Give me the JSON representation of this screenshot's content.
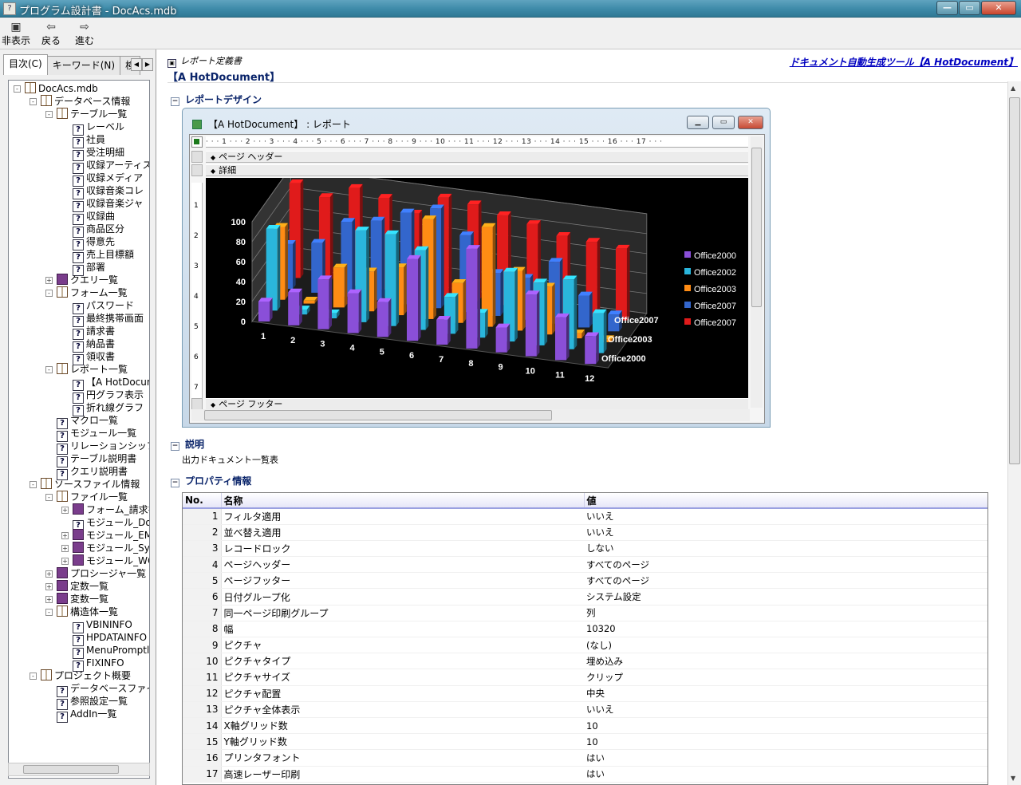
{
  "window": {
    "title": "プログラム設計書 - DocAcs.mdb"
  },
  "toolbar": {
    "hide": "非表示",
    "back": "戻る",
    "forward": "進む"
  },
  "left": {
    "tabs": [
      "目次(C)",
      "キーワード(N)",
      "検"
    ],
    "tree": [
      {
        "label": "DocAcs.mdb",
        "level": 0,
        "icon": "book-open",
        "exp": "-"
      },
      {
        "label": "データベース情報",
        "level": 1,
        "icon": "book-open",
        "exp": "-"
      },
      {
        "label": "テーブル一覧",
        "level": 2,
        "icon": "book-open",
        "exp": "-"
      },
      {
        "label": "レーベル",
        "level": 3,
        "icon": "page",
        "exp": ""
      },
      {
        "label": "社員",
        "level": 3,
        "icon": "page",
        "exp": ""
      },
      {
        "label": "受注明細",
        "level": 3,
        "icon": "page",
        "exp": ""
      },
      {
        "label": "収録アーティス",
        "level": 3,
        "icon": "page",
        "exp": ""
      },
      {
        "label": "収録メディア",
        "level": 3,
        "icon": "page",
        "exp": ""
      },
      {
        "label": "収録音楽コレ",
        "level": 3,
        "icon": "page",
        "exp": ""
      },
      {
        "label": "収録音楽ジャ",
        "level": 3,
        "icon": "page",
        "exp": ""
      },
      {
        "label": "収録曲",
        "level": 3,
        "icon": "page",
        "exp": ""
      },
      {
        "label": "商品区分",
        "level": 3,
        "icon": "page",
        "exp": ""
      },
      {
        "label": "得意先",
        "level": 3,
        "icon": "page",
        "exp": ""
      },
      {
        "label": "売上目標額",
        "level": 3,
        "icon": "page",
        "exp": ""
      },
      {
        "label": "部署",
        "level": 3,
        "icon": "page",
        "exp": ""
      },
      {
        "label": "クエリ一覧",
        "level": 2,
        "icon": "book-closed",
        "exp": "+"
      },
      {
        "label": "フォーム一覧",
        "level": 2,
        "icon": "book-open",
        "exp": "-"
      },
      {
        "label": "パスワード",
        "level": 3,
        "icon": "page",
        "exp": ""
      },
      {
        "label": "最終携帯画面",
        "level": 3,
        "icon": "page",
        "exp": ""
      },
      {
        "label": "請求書",
        "level": 3,
        "icon": "page",
        "exp": ""
      },
      {
        "label": "納品書",
        "level": 3,
        "icon": "page",
        "exp": ""
      },
      {
        "label": "領収書",
        "level": 3,
        "icon": "page",
        "exp": ""
      },
      {
        "label": "レポート一覧",
        "level": 2,
        "icon": "book-open",
        "exp": "-"
      },
      {
        "label": "【A HotDocun",
        "level": 3,
        "icon": "page",
        "exp": ""
      },
      {
        "label": "円グラフ表示",
        "level": 3,
        "icon": "page",
        "exp": ""
      },
      {
        "label": "折れ線グラフ",
        "level": 3,
        "icon": "page",
        "exp": ""
      },
      {
        "label": "マクロ一覧",
        "level": 2,
        "icon": "page",
        "exp": ""
      },
      {
        "label": "モジュール一覧",
        "level": 2,
        "icon": "page",
        "exp": ""
      },
      {
        "label": "リレーションシップ定",
        "level": 2,
        "icon": "page",
        "exp": ""
      },
      {
        "label": "テーブル説明書",
        "level": 2,
        "icon": "page",
        "exp": ""
      },
      {
        "label": "クエリ説明書",
        "level": 2,
        "icon": "page",
        "exp": ""
      },
      {
        "label": "ソースファイル情報",
        "level": 1,
        "icon": "book-open",
        "exp": "-"
      },
      {
        "label": "ファイル一覧",
        "level": 2,
        "icon": "book-open",
        "exp": "-"
      },
      {
        "label": "フォーム_請求書",
        "level": 3,
        "icon": "book-closed",
        "exp": "+"
      },
      {
        "label": "モジュール_DocS",
        "level": 3,
        "icon": "page",
        "exp": ""
      },
      {
        "label": "モジュール_EMes",
        "level": 3,
        "icon": "book-closed",
        "exp": "+"
      },
      {
        "label": "モジュール_Syste",
        "level": 3,
        "icon": "book-closed",
        "exp": "+"
      },
      {
        "label": "モジュール_WCE",
        "level": 3,
        "icon": "book-closed",
        "exp": "+"
      },
      {
        "label": "プロシージャ一覧",
        "level": 2,
        "icon": "book-closed",
        "exp": "+"
      },
      {
        "label": "定数一覧",
        "level": 2,
        "icon": "book-closed",
        "exp": "+"
      },
      {
        "label": "変数一覧",
        "level": 2,
        "icon": "book-closed",
        "exp": "+"
      },
      {
        "label": "構造体一覧",
        "level": 2,
        "icon": "book-open",
        "exp": "-"
      },
      {
        "label": "VBININFO",
        "level": 3,
        "icon": "page",
        "exp": ""
      },
      {
        "label": "HPDATAINFO",
        "level": 3,
        "icon": "page",
        "exp": ""
      },
      {
        "label": "MenuPromptl",
        "level": 3,
        "icon": "page",
        "exp": ""
      },
      {
        "label": "FIXINFO",
        "level": 3,
        "icon": "page",
        "exp": ""
      },
      {
        "label": "プロジェクト概要",
        "level": 1,
        "icon": "book-open",
        "exp": "-"
      },
      {
        "label": "データベースファイル",
        "level": 2,
        "icon": "page",
        "exp": ""
      },
      {
        "label": "参照設定一覧",
        "level": 2,
        "icon": "page",
        "exp": ""
      },
      {
        "label": "AddIn一覧",
        "level": 2,
        "icon": "page",
        "exp": ""
      }
    ]
  },
  "content": {
    "breadcrumb": "レポート定義書",
    "title": "【A HotDocument】",
    "tool_link": "ドキュメント自動生成ツール【A HotDocument】",
    "sections": {
      "design": "レポートデザイン",
      "description": "説明",
      "properties": "プロパティ情報"
    },
    "description_text": "出力ドキュメント一覧表",
    "report_window": {
      "title": "【A HotDocument】 : レポート",
      "ruler": "· · · 1 · · · 2 · · · 3 · · · 4 · · · 5 · · · 6 · · · 7 · · · 8 · · · 9 · · · 10 · · · 11 · · · 12 · · · 13 · · · 14 · · · 15 · · · 16 · · · 17 · · ·",
      "bands": {
        "page_header": "ページ ヘッダー",
        "detail": "詳細",
        "page_footer": "ページ フッター"
      }
    },
    "table": {
      "headers": [
        "No.",
        "名称",
        "値"
      ],
      "rows": [
        [
          "1",
          "フィルタ適用",
          "いいえ"
        ],
        [
          "2",
          "並べ替え適用",
          "いいえ"
        ],
        [
          "3",
          "レコードロック",
          "しない"
        ],
        [
          "4",
          "ページヘッダー",
          "すべてのページ"
        ],
        [
          "5",
          "ページフッター",
          "すべてのページ"
        ],
        [
          "6",
          "日付グループ化",
          "システム設定"
        ],
        [
          "7",
          "同一ページ印刷グループ",
          "列"
        ],
        [
          "8",
          "幅",
          "10320"
        ],
        [
          "9",
          "ピクチャ",
          "(なし)"
        ],
        [
          "10",
          "ピクチャタイプ",
          "埋め込み"
        ],
        [
          "11",
          "ピクチャサイズ",
          "クリップ"
        ],
        [
          "12",
          "ピクチャ配置",
          "中央"
        ],
        [
          "13",
          "ピクチャ全体表示",
          "いいえ"
        ],
        [
          "14",
          "X軸グリッド数",
          "10"
        ],
        [
          "15",
          "Y軸グリッド数",
          "10"
        ],
        [
          "16",
          "プリンタフォント",
          "はい"
        ],
        [
          "17",
          "高速レーザー印刷",
          "はい"
        ]
      ]
    }
  },
  "chart_data": {
    "type": "bar",
    "categories": [
      "1",
      "2",
      "3",
      "4",
      "5",
      "6",
      "7",
      "8",
      "9",
      "10",
      "11",
      "12"
    ],
    "ylim": [
      0,
      100
    ],
    "yticks": [
      "0",
      "20",
      "40",
      "60",
      "80",
      "100"
    ],
    "depth_labels": [
      "Office2007",
      "Office2003",
      "Office2000"
    ],
    "series": [
      {
        "name": "Office2000",
        "color": "#8a4fd8",
        "values": [
          20,
          33,
          50,
          40,
          35,
          82,
          25,
          100,
          25,
          62,
          43,
          28
        ]
      },
      {
        "name": "Office2002",
        "color": "#2ab6dc",
        "values": [
          82,
          5,
          5,
          92,
          92,
          80,
          37,
          25,
          70,
          63,
          70,
          40
        ]
      },
      {
        "name": "Office2003",
        "color": "#ff8c14",
        "values": [
          73,
          3,
          40,
          40,
          48,
          100,
          40,
          100,
          60,
          48,
          5,
          3
        ]
      },
      {
        "name": "Office2007",
        "color": "#3366cc",
        "values": [
          45,
          50,
          75,
          80,
          92,
          100,
          77,
          43,
          42,
          62,
          32,
          17
        ]
      },
      {
        "name": "Office2007",
        "color": "#e01b1b",
        "values": [
          95,
          85,
          98,
          92,
          80,
          100,
          97,
          90,
          85,
          77,
          75,
          72
        ]
      }
    ]
  }
}
